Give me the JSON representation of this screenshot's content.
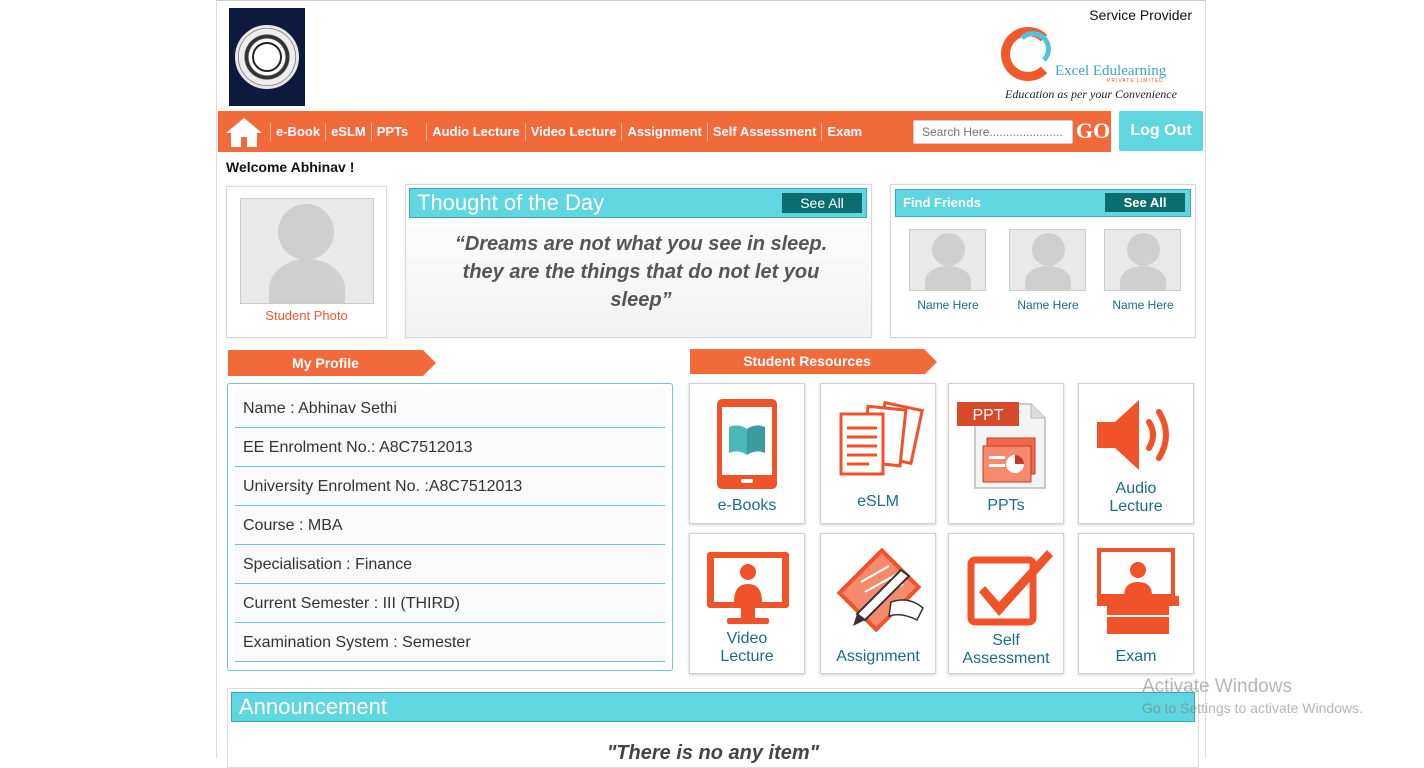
{
  "header": {
    "service_provider": "Service Provider",
    "brand_name": "Excel Edulearning",
    "brand_sub": "PRIVATE LIMITED",
    "brand_tagline": "Education as per your Convenience"
  },
  "nav": {
    "items": [
      "e-Book",
      "eSLM",
      "PPTs",
      "Audio Lecture",
      "Video Lecture",
      "Assignment",
      "Self Assessment",
      "Exam"
    ],
    "search_placeholder": "Search Here.......................",
    "go_label": "GO",
    "logout_label": "Log Out"
  },
  "welcome": "Welcome Abhinav !",
  "photo": {
    "label": "Student Photo"
  },
  "thought": {
    "title": "Thought of the Day",
    "see_all": "See All",
    "quote": "“Dreams are not what you see in sleep. they are the things that do not let you sleep”"
  },
  "friends": {
    "title": "Find Friends",
    "see_all": "See All",
    "names": [
      "Name Here",
      "Name Here",
      "Name Here"
    ]
  },
  "profile": {
    "title": "My Profile",
    "rows": [
      "Name : Abhinav Sethi",
      "EE Enrolment No.: A8C7512013",
      "University Enrolment No. :A8C7512013",
      "Course : MBA",
      "Specialisation : Finance",
      "Current Semester : III (THIRD)",
      "Examination System : Semester"
    ]
  },
  "resources": {
    "title": "Student Resources",
    "tiles": {
      "ebooks": "e-Books",
      "eslm": "eSLM",
      "ppts": "PPTs",
      "ppt_badge": "PPT",
      "audio_1": "Audio",
      "audio_2": "Lecture",
      "video_1": "Video",
      "video_2": "Lecture",
      "assignment": "Assignment",
      "self_1": "Self",
      "self_2": "Assessment",
      "exam": "Exam"
    }
  },
  "announcement": {
    "title": "Announcement",
    "empty": "\"There is no any item\""
  },
  "watermark": {
    "line1": "Activate Windows",
    "line2": "Go to Settings to activate Windows."
  },
  "colors": {
    "orange": "#f26a3a",
    "teal": "#5fd6e0",
    "dark_teal": "#0b6d6e",
    "link": "#1b6d86"
  }
}
